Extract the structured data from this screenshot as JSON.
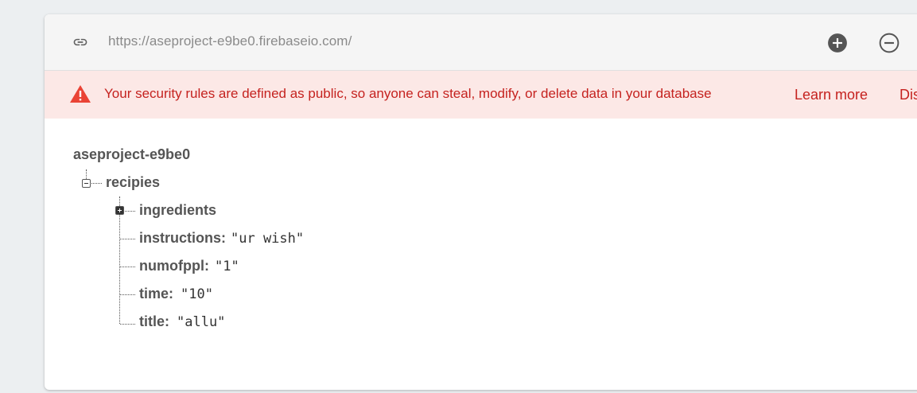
{
  "urlbar": {
    "url": "https://aseproject-e9be0.firebaseio.com/",
    "add_icon": "add-circle-icon",
    "remove_icon": "remove-circle-icon",
    "link_icon": "link-icon"
  },
  "warning": {
    "icon": "warning-triangle-icon",
    "message": "Your security rules are defined as public, so anyone can steal, modify, or delete data in your database",
    "learn_more": "Learn more",
    "dismiss": "Dis",
    "colors": {
      "background": "#fce8e6",
      "text": "#c5221f"
    }
  },
  "tree": {
    "root": "aseproject-e9be0",
    "node": {
      "key": "recipies",
      "children": [
        {
          "key": "ingredients",
          "sep": "",
          "value": ""
        },
        {
          "key": "instructions",
          "sep": ":",
          "value": "\"ur wish\""
        },
        {
          "key": "numofppl",
          "sep": ":",
          "value": "\"1\""
        },
        {
          "key": "time",
          "sep": ":",
          "value": "\"10\""
        },
        {
          "key": "title",
          "sep": ":",
          "value": "\"allu\""
        }
      ]
    }
  }
}
